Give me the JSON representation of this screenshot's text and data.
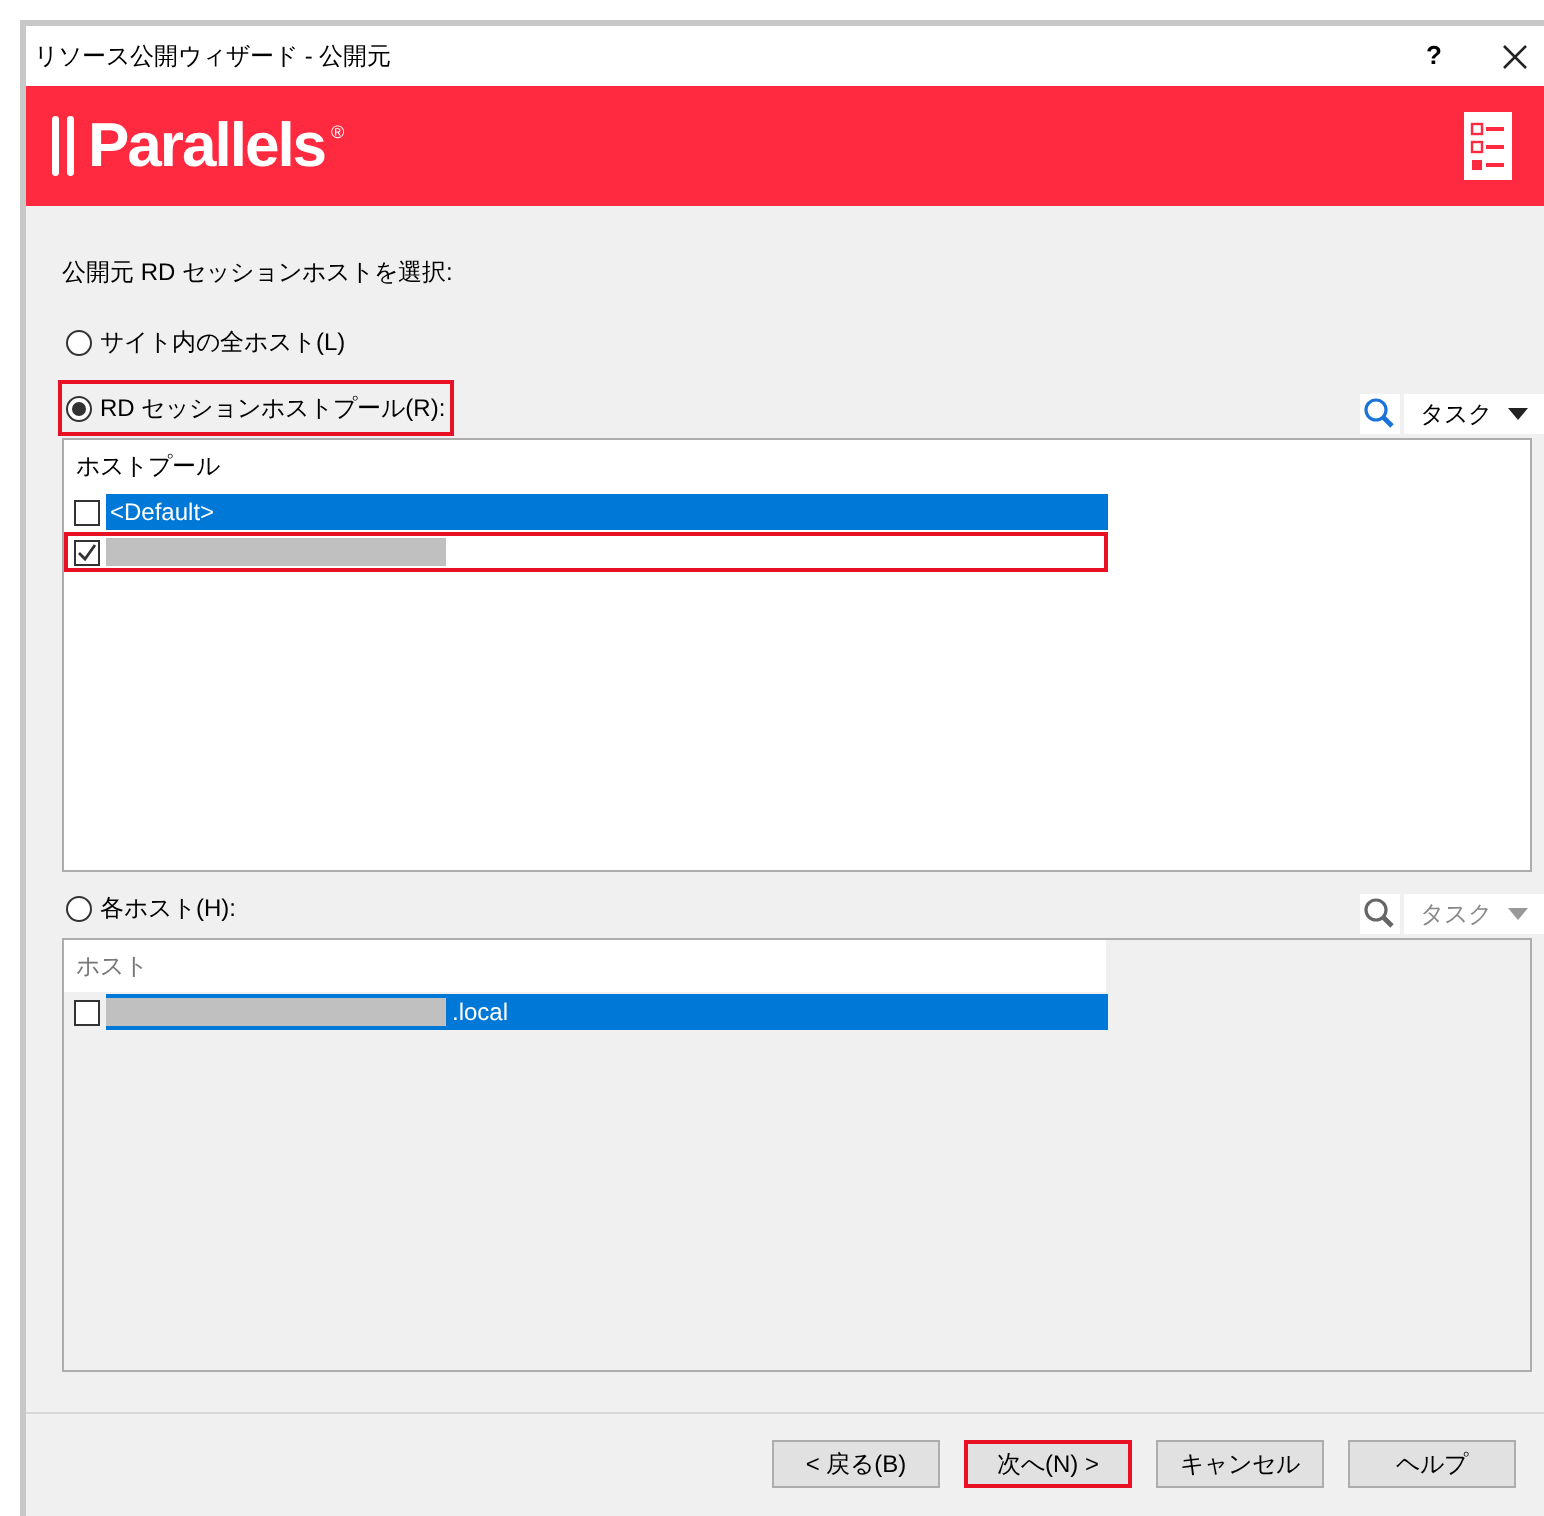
{
  "window": {
    "title": "リソース公開ウィザード - 公開元",
    "help": "?"
  },
  "banner": {
    "logo": "Parallels",
    "mark": "®"
  },
  "prompt": "公開元 RD セッションホストを選択:",
  "options": [
    {
      "kind": "plain",
      "label": "サイト内の全ホスト(L)",
      "selected": false,
      "highlighted": false
    },
    {
      "kind": "list",
      "label": "RD セッションホストプール(R):",
      "selected": true,
      "highlighted": true,
      "task": "タスク",
      "header": "ホストプール",
      "rows": [
        {
          "text": "<Default>",
          "redacted": false,
          "checked": false,
          "selected": true,
          "highlighted": false
        },
        {
          "redacted": true,
          "checked": true,
          "selected": false,
          "highlighted": true
        }
      ]
    },
    {
      "kind": "list",
      "label": "各ホスト(H):",
      "selected": false,
      "highlighted": false,
      "task": "タスク",
      "header": "ホスト",
      "rows": [
        {
          "text": ".local",
          "redacted": true,
          "checked": false,
          "selected": true,
          "highlighted": false
        }
      ]
    }
  ],
  "buttons": [
    {
      "label": "< 戻る(B)",
      "highlighted": false
    },
    {
      "label": "次へ(N) >",
      "highlighted": true
    },
    {
      "label": "キャンセル",
      "highlighted": false
    },
    {
      "label": "ヘルプ",
      "highlighted": false
    }
  ]
}
